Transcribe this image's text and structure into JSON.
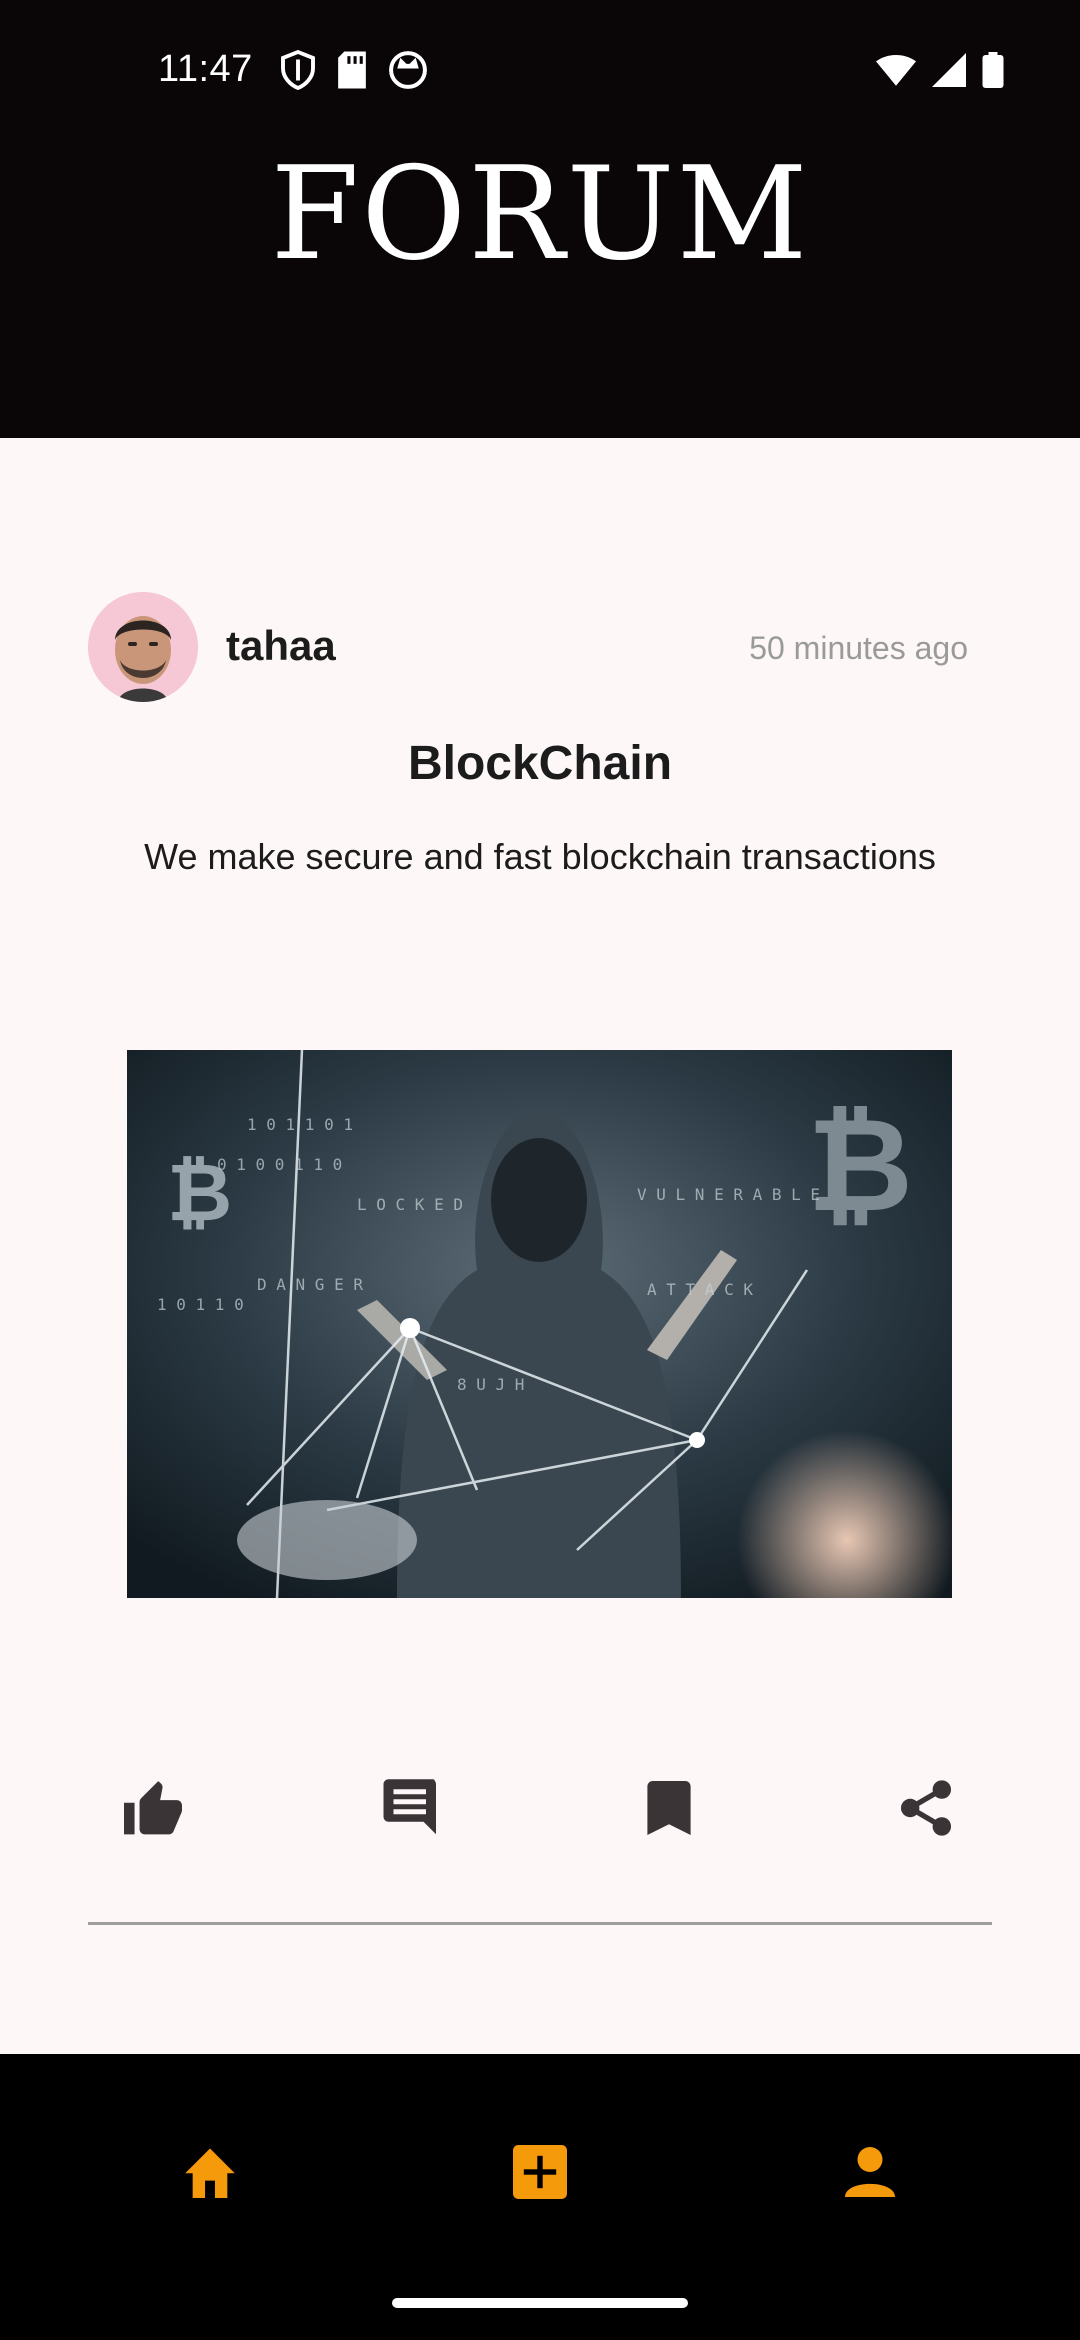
{
  "status_bar": {
    "time": "11:47",
    "left_icons": [
      "shield-icon",
      "sd-card-icon",
      "cat-face-icon"
    ],
    "right_icons": [
      "wifi-icon",
      "cellular-signal-icon",
      "battery-icon"
    ]
  },
  "header": {
    "title": "FORUM"
  },
  "post": {
    "author": "tahaa",
    "timestamp": "50 minutes ago",
    "title": "BlockChain",
    "body": "We make secure and fast blockchain transactions",
    "image": "blockchain-hacker-image",
    "actions": [
      "like-icon",
      "comment-icon",
      "bookmark-icon",
      "share-icon"
    ]
  },
  "bottom_nav": {
    "items": [
      "home-icon",
      "add-post-icon",
      "profile-icon"
    ],
    "accent": "#f59a0b"
  },
  "colors": {
    "header_bg": "#0a0608",
    "page_bg": "#fdf8f7",
    "icon_dark": "#3a3436"
  }
}
